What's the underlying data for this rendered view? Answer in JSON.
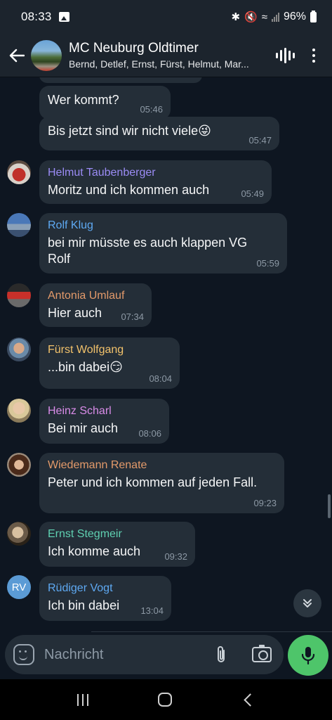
{
  "status_bar": {
    "time": "08:33",
    "battery": "96%"
  },
  "header": {
    "title": "MC Neuburg Oldtimer",
    "members": "Bernd, Detlef, Ernst, Fürst, Helmut, Mar..."
  },
  "messages": [
    {
      "sender": "",
      "text": "Wer kommt?",
      "time": "05:46"
    },
    {
      "sender": "",
      "text": "Bis jetzt sind wir nicht viele😜",
      "time": "05:47"
    },
    {
      "sender": "Helmut Taubenberger",
      "sender_color": "#9b8cf5",
      "text": "Moritz und ich kommen auch",
      "time": "05:49"
    },
    {
      "sender": "Rolf Klug",
      "sender_color": "#5ea9f2",
      "text": "bei mir müsste es auch klappen   VG Rolf",
      "time": "05:59"
    },
    {
      "sender": "Antonia Umlauf",
      "sender_color": "#e39a6a",
      "text": "Hier auch",
      "time": "07:34"
    },
    {
      "sender": "Fürst Wolfgang",
      "sender_color": "#f2c26b",
      "text": "...bin dabei😏",
      "time": "08:04"
    },
    {
      "sender": "Heinz Scharl",
      "sender_color": "#d98ce8",
      "text": "Bei mir auch",
      "time": "08:06"
    },
    {
      "sender": "Wiedemann Renate",
      "sender_color": "#e39a6a",
      "text": "Peter und ich kommen auf jeden Fall.",
      "time": "09:23"
    },
    {
      "sender": "Ernst Stegmeir",
      "sender_color": "#5fd0b1",
      "text": "Ich komme auch",
      "time": "09:32"
    },
    {
      "sender": "Rüdiger Vogt",
      "sender_color": "#5ea9f2",
      "text": "Ich bin dabei",
      "time": "13:04",
      "avatar_initials": "RV"
    }
  ],
  "input": {
    "placeholder": "Nachricht"
  },
  "colors": {
    "background": "#0e1621",
    "bubble": "#242e38",
    "header": "#1c242d",
    "accent_mic": "#4ec56a"
  }
}
